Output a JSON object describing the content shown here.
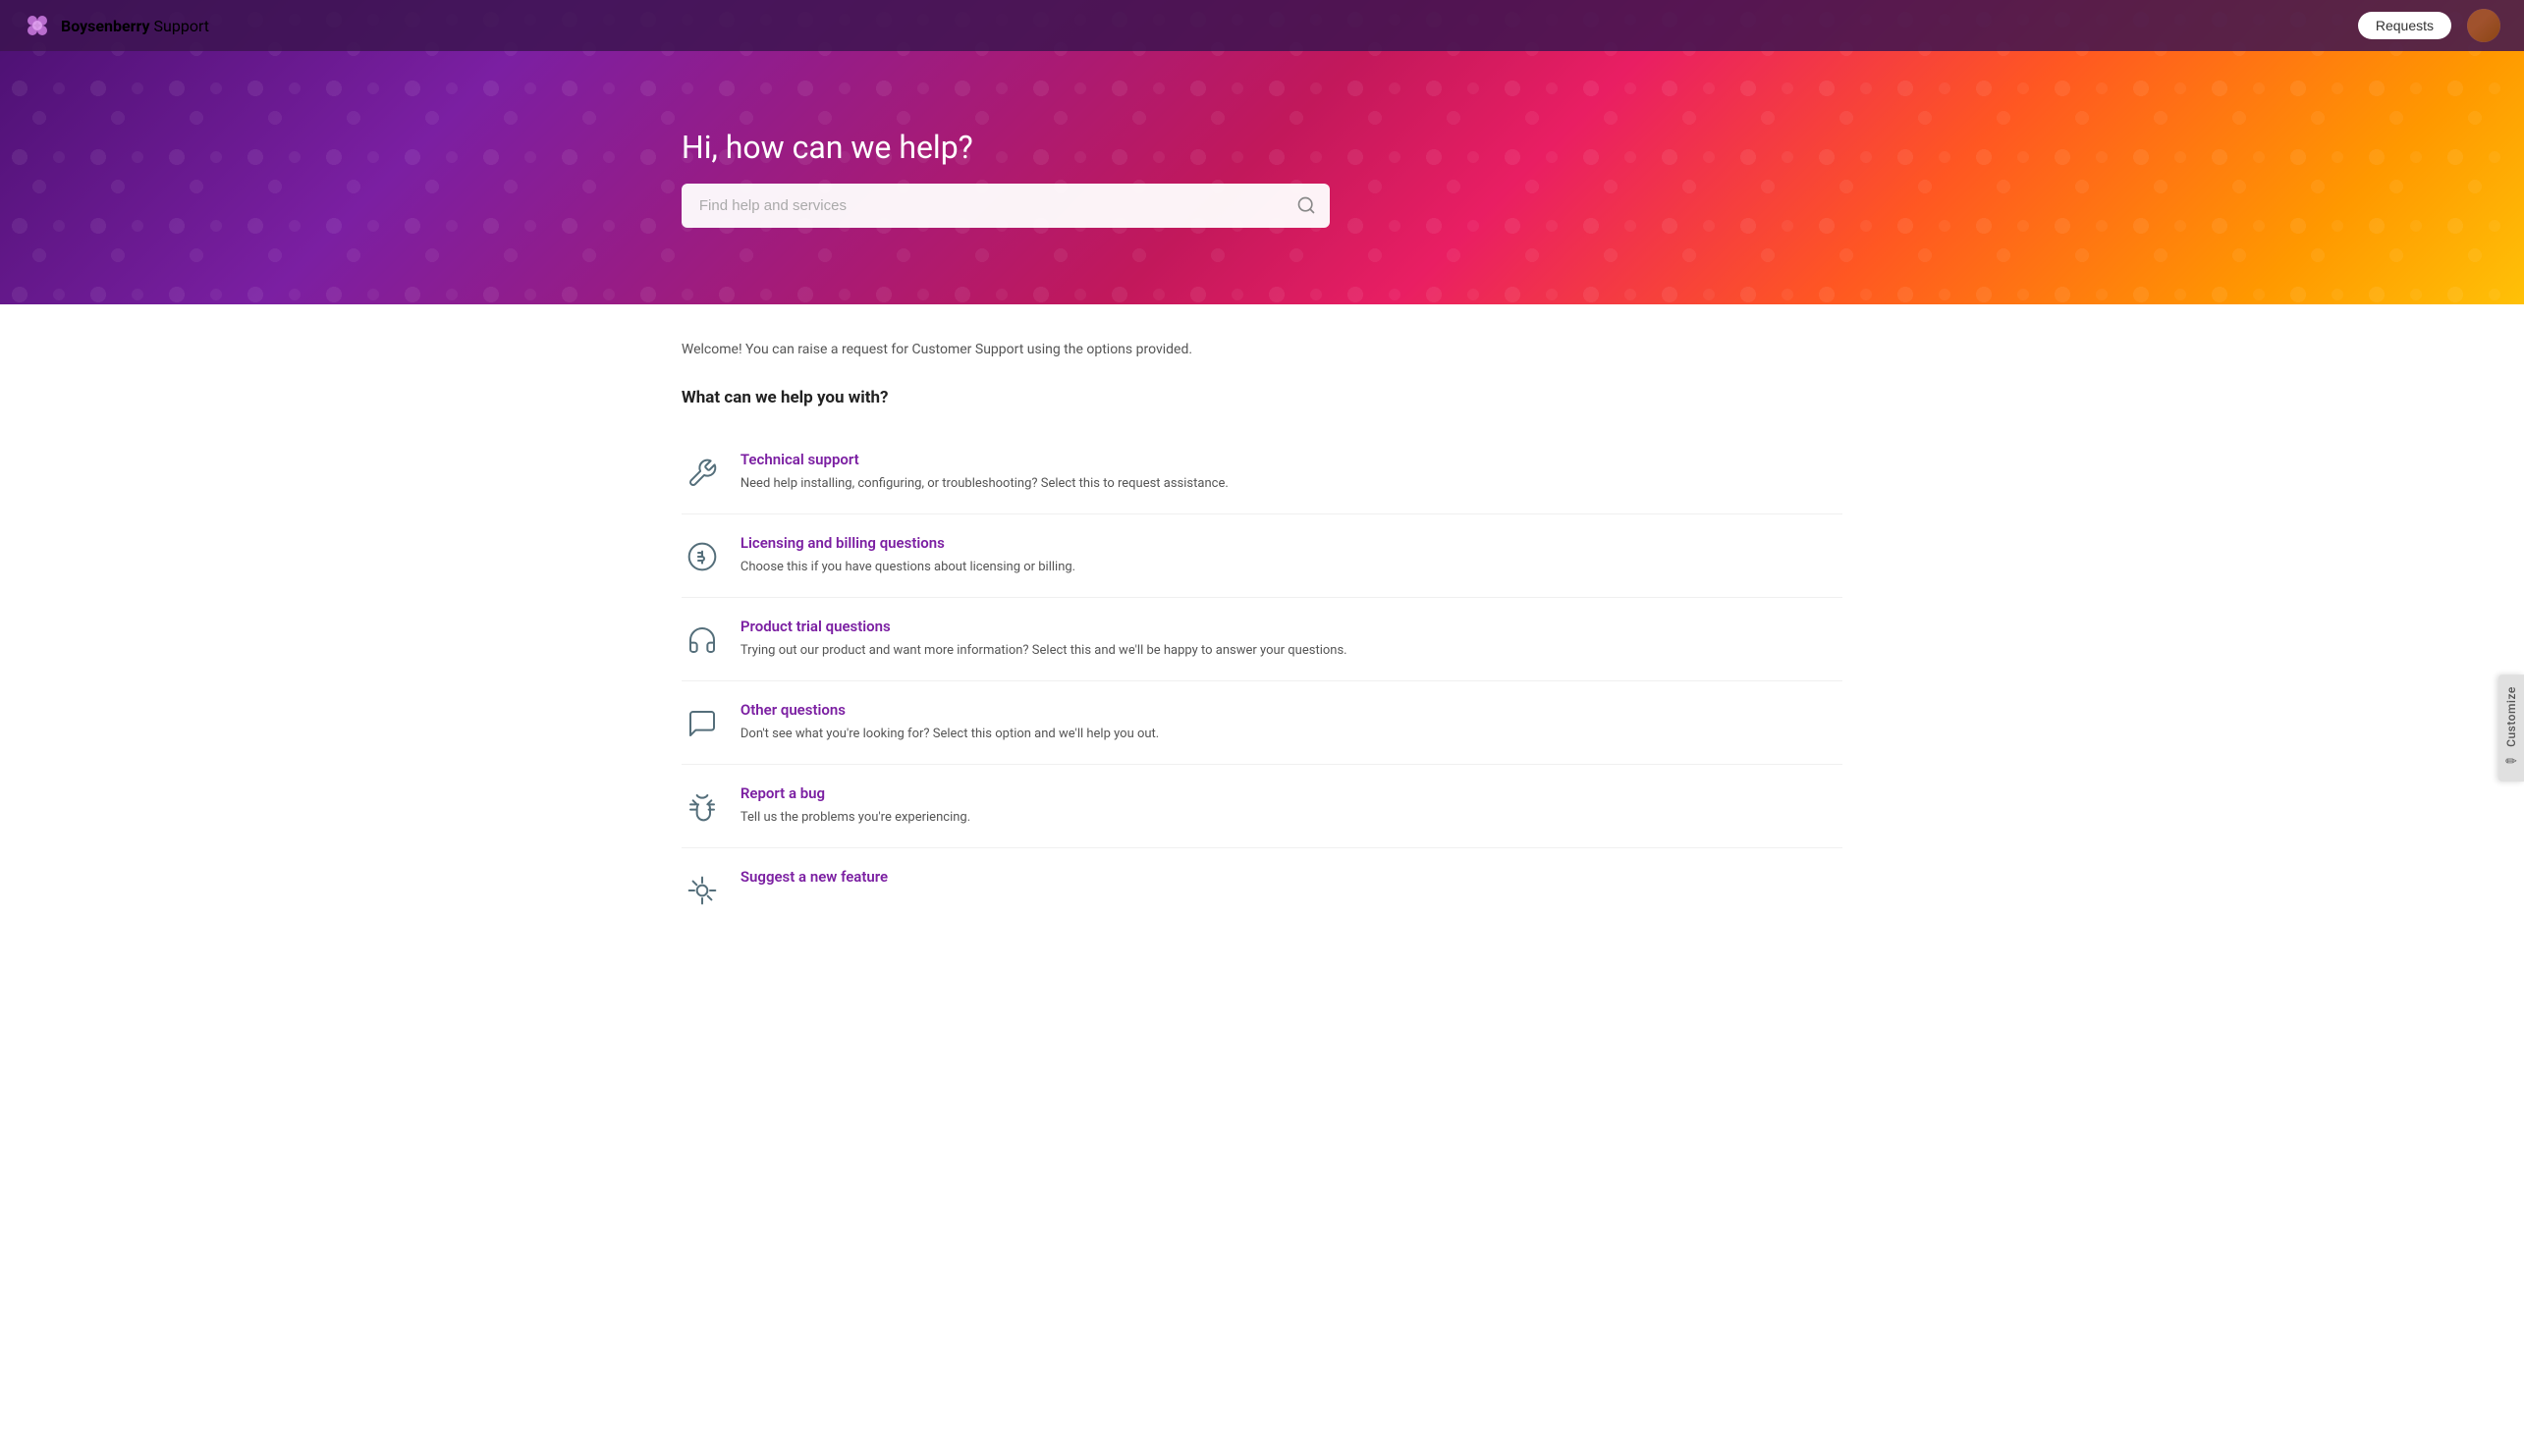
{
  "header": {
    "logo_brand": "Boysenberry",
    "logo_suffix": " Support",
    "requests_label": "Requests"
  },
  "hero": {
    "title": "Hi, how can we help?",
    "search_placeholder": "Find help and services"
  },
  "customize_tab": {
    "label": "Customize"
  },
  "main": {
    "welcome_text": "Welcome! You can raise a request for Customer Support using the options provided.",
    "section_title": "What can we help you with?",
    "services": [
      {
        "id": "technical-support",
        "title": "Technical support",
        "description": "Need help installing, configuring, or troubleshooting? Select this to request assistance.",
        "icon": "tools"
      },
      {
        "id": "licensing-billing",
        "title": "Licensing and billing questions",
        "description": "Choose this if you have questions about licensing or billing.",
        "icon": "dollar"
      },
      {
        "id": "product-trial",
        "title": "Product trial questions",
        "description": "Trying out our product and want more information? Select this and we'll be happy to answer your questions.",
        "icon": "headset"
      },
      {
        "id": "other-questions",
        "title": "Other questions",
        "description": "Don't see what you're looking for? Select this option and we'll help you out.",
        "icon": "chat"
      },
      {
        "id": "report-bug",
        "title": "Report a bug",
        "description": "Tell us the problems you're experiencing.",
        "icon": "bug"
      },
      {
        "id": "suggest-feature",
        "title": "Suggest a new feature",
        "description": "",
        "icon": "lightbulb"
      }
    ]
  }
}
